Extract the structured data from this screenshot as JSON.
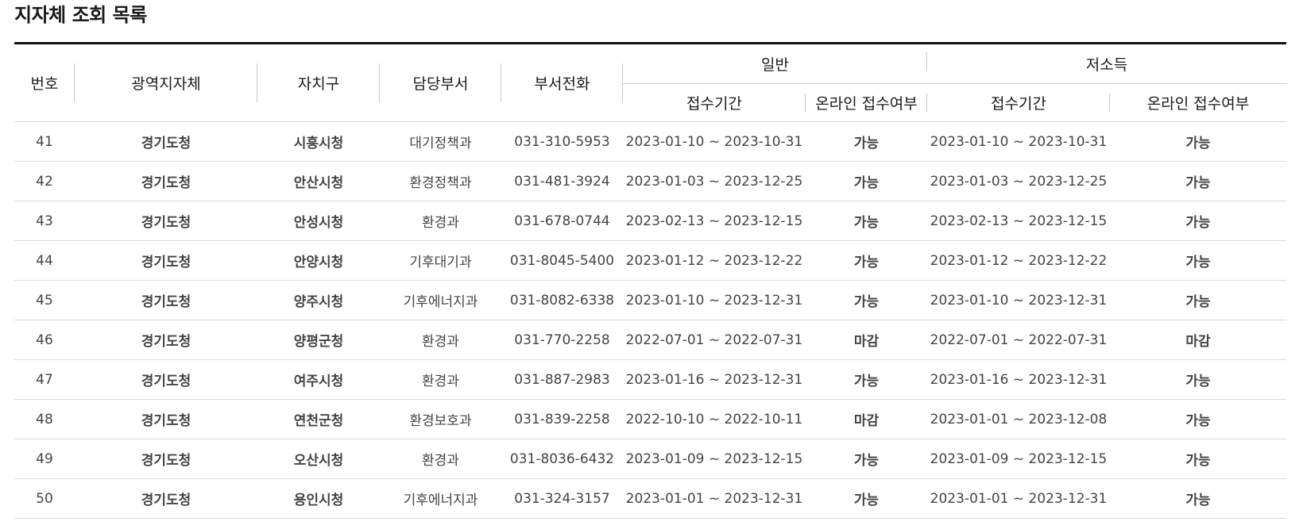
{
  "page": {
    "title": "지자체 조회 목록"
  },
  "colors": {
    "accent_open": "#2f73e8",
    "closed": "#1a1a1a",
    "header_rule": "#111111"
  },
  "table": {
    "headers": {
      "number": "번호",
      "province": "광역지자체",
      "district": "자치구",
      "department": "담당부서",
      "phone": "부서전화",
      "general": "일반",
      "low_income": "저소득",
      "period": "접수기간",
      "online": "온라인 접수여부"
    },
    "rows": [
      {
        "no": "41",
        "province": "경기도청",
        "district": "시흥시청",
        "department": "대기정책과",
        "phone": "031-310-5953",
        "general_period": "2023-01-10 ~ 2023-10-31",
        "general_online": "가능",
        "low_period": "2023-01-10 ~ 2023-10-31",
        "low_online": "가능"
      },
      {
        "no": "42",
        "province": "경기도청",
        "district": "안산시청",
        "department": "환경정책과",
        "phone": "031-481-3924",
        "general_period": "2023-01-03 ~ 2023-12-25",
        "general_online": "가능",
        "low_period": "2023-01-03 ~ 2023-12-25",
        "low_online": "가능"
      },
      {
        "no": "43",
        "province": "경기도청",
        "district": "안성시청",
        "department": "환경과",
        "phone": "031-678-0744",
        "general_period": "2023-02-13 ~ 2023-12-15",
        "general_online": "가능",
        "low_period": "2023-02-13 ~ 2023-12-15",
        "low_online": "가능"
      },
      {
        "no": "44",
        "province": "경기도청",
        "district": "안양시청",
        "department": "기후대기과",
        "phone": "031-8045-5400",
        "general_period": "2023-01-12 ~ 2023-12-22",
        "general_online": "가능",
        "low_period": "2023-01-12 ~ 2023-12-22",
        "low_online": "가능"
      },
      {
        "no": "45",
        "province": "경기도청",
        "district": "양주시청",
        "department": "기후에너지과",
        "phone": "031-8082-6338",
        "general_period": "2023-01-10 ~ 2023-12-31",
        "general_online": "가능",
        "low_period": "2023-01-10 ~ 2023-12-31",
        "low_online": "가능"
      },
      {
        "no": "46",
        "province": "경기도청",
        "district": "양평군청",
        "department": "환경과",
        "phone": "031-770-2258",
        "general_period": "2022-07-01 ~ 2022-07-31",
        "general_online": "마감",
        "low_period": "2022-07-01 ~ 2022-07-31",
        "low_online": "마감"
      },
      {
        "no": "47",
        "province": "경기도청",
        "district": "여주시청",
        "department": "환경과",
        "phone": "031-887-2983",
        "general_period": "2023-01-16 ~ 2023-12-31",
        "general_online": "가능",
        "low_period": "2023-01-16 ~ 2023-12-31",
        "low_online": "가능"
      },
      {
        "no": "48",
        "province": "경기도청",
        "district": "연천군청",
        "department": "환경보호과",
        "phone": "031-839-2258",
        "general_period": "2022-10-10 ~ 2022-10-11",
        "general_online": "마감",
        "low_period": "2023-01-01 ~ 2023-12-08",
        "low_online": "가능"
      },
      {
        "no": "49",
        "province": "경기도청",
        "district": "오산시청",
        "department": "환경과",
        "phone": "031-8036-6432",
        "general_period": "2023-01-09 ~ 2023-12-15",
        "general_online": "가능",
        "low_period": "2023-01-09 ~ 2023-12-15",
        "low_online": "가능"
      },
      {
        "no": "50",
        "province": "경기도청",
        "district": "용인시청",
        "department": "기후에너지과",
        "phone": "031-324-3157",
        "general_period": "2023-01-01 ~ 2023-12-31",
        "general_online": "가능",
        "low_period": "2023-01-01 ~ 2023-12-31",
        "low_online": "가능"
      }
    ]
  }
}
